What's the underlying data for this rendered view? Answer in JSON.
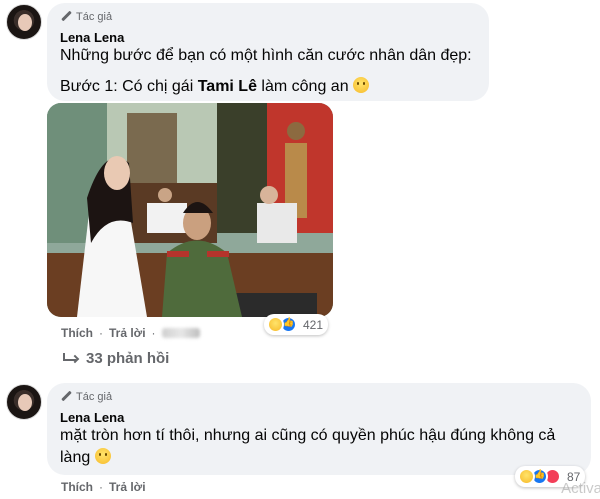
{
  "comment1": {
    "badge": "Tác giả",
    "author": "Lena Lena",
    "line1": "Những bước để bạn có một hình căn cước nhân dân đẹp:",
    "line2_prefix": "Bước 1: Có chị gái ",
    "line2_bold": "Tami Lê",
    "line2_suffix": " làm công an ",
    "emoji": "laughing-tears",
    "actions": {
      "like": "Thích",
      "sep": "·",
      "reply": "Trả lời",
      "sep2": "·"
    },
    "reaction_count": "421",
    "reactions": [
      "haha",
      "like"
    ],
    "replies_label": "33 phản hồi"
  },
  "comment2": {
    "badge": "Tác giả",
    "author": "Lena Lena",
    "text": "mặt tròn hơn tí thôi, nhưng ai cũng có quyền phúc hậu đúng không cả làng ",
    "emoji": "grin",
    "actions": {
      "like": "Thích",
      "sep": "·",
      "reply": "Trả lời"
    },
    "reaction_count": "87",
    "reactions": [
      "haha",
      "like",
      "love"
    ]
  },
  "watermark": "Activa",
  "colors": {
    "bubble": "#f0f2f5",
    "muted": "#65676b",
    "text": "#050505",
    "like": "#1877f2"
  }
}
